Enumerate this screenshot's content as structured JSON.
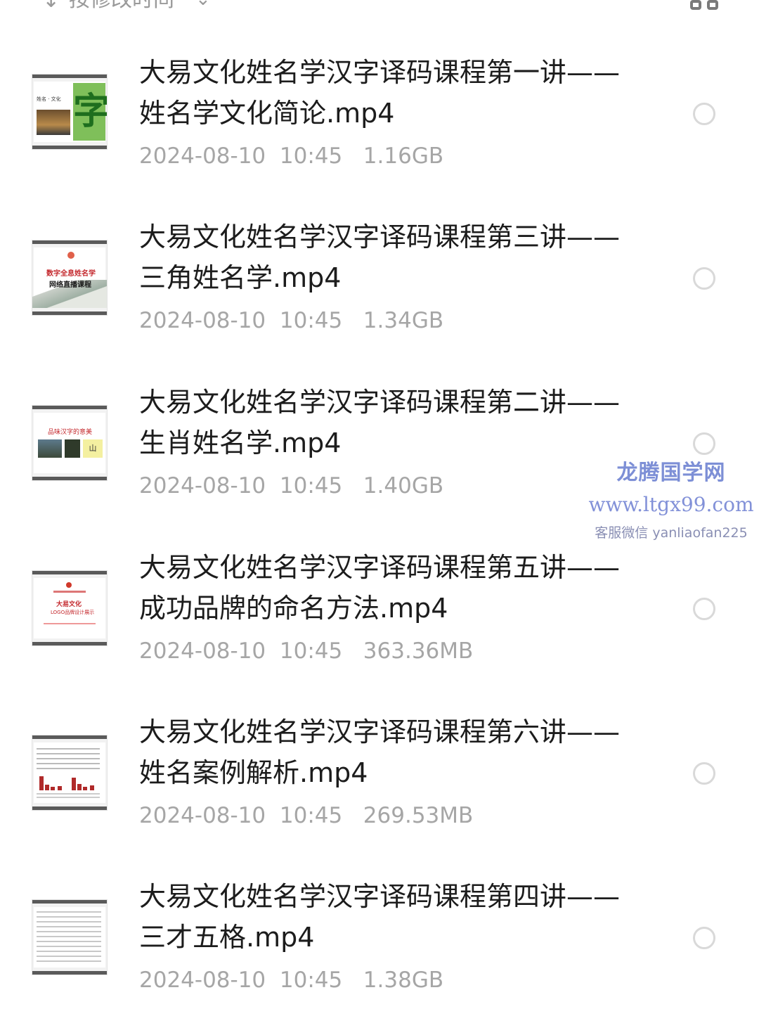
{
  "sort": {
    "label": "按修改时间",
    "arrow_icon": "sort-down-arrow-icon",
    "chevron_icon": "chevron-down-icon",
    "view_icon": "grid-view-icon"
  },
  "files": [
    {
      "title": "大易文化姓名学汉字译码课程第一讲——姓名学文化简论.mp4",
      "date": "2024-08-10",
      "time": "10:45",
      "size": "1.16GB",
      "thumb_text": "字"
    },
    {
      "title": "大易文化姓名学汉字译码课程第三讲——三角姓名学.mp4",
      "date": "2024-08-10",
      "time": "10:45",
      "size": "1.34GB",
      "thumb_text_1": "数字全息姓名学",
      "thumb_text_2": "网络直播课程"
    },
    {
      "title": "大易文化姓名学汉字译码课程第二讲——生肖姓名学.mp4",
      "date": "2024-08-10",
      "time": "10:45",
      "size": "1.40GB",
      "thumb_text_1": "品味汉字的意美",
      "thumb_text_2": "山"
    },
    {
      "title": "大易文化姓名学汉字译码课程第五讲——成功品牌的命名方法.mp4",
      "date": "2024-08-10",
      "time": "10:45",
      "size": "363.36MB",
      "thumb_text_1": "大易文化",
      "thumb_text_2": "LOGO品牌设计展示"
    },
    {
      "title": "大易文化姓名学汉字译码课程第六讲——姓名案例解析.mp4",
      "date": "2024-08-10",
      "time": "10:45",
      "size": "269.53MB"
    },
    {
      "title": "大易文化姓名学汉字译码课程第四讲——三才五格.mp4",
      "date": "2024-08-10",
      "time": "10:45",
      "size": "1.38GB"
    }
  ],
  "watermark": {
    "title": "龙腾国学网",
    "url": "www.ltgx99.com",
    "contact": "客服微信 yanliaofan225"
  }
}
